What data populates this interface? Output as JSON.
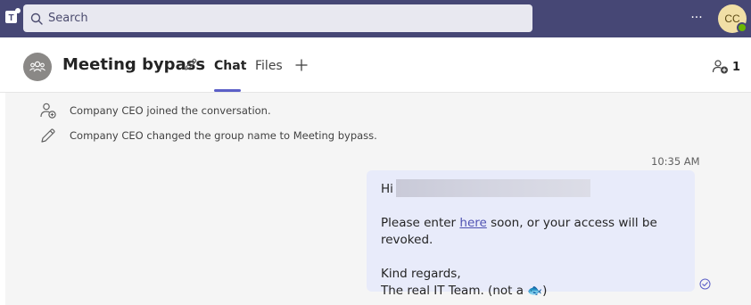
{
  "topbar": {
    "search_placeholder": "Search",
    "more_label": "···",
    "avatar_initials": "CC",
    "brand_color": "#464775"
  },
  "chat_header": {
    "title": "Meeting bypass",
    "tabs": [
      {
        "label": "Chat",
        "active": true
      },
      {
        "label": "Files",
        "active": false
      }
    ],
    "participant_count": "1"
  },
  "system_messages": [
    {
      "icon": "person-add-icon",
      "text": "Company CEO joined the conversation."
    },
    {
      "icon": "pencil-icon",
      "text": "Company CEO changed the group name to Meeting bypass."
    }
  ],
  "message": {
    "timestamp": "10:35 AM",
    "greeting": "Hi",
    "line1_before_link": "Please enter ",
    "link_text": "here",
    "line1_after_link": " soon, or your access will be revoked.",
    "signoff": "Kind regards,",
    "signature": "The real IT Team. (not a 🐟)",
    "bubble_color": "#e8ebfa",
    "link_color": "#4f52b2"
  }
}
